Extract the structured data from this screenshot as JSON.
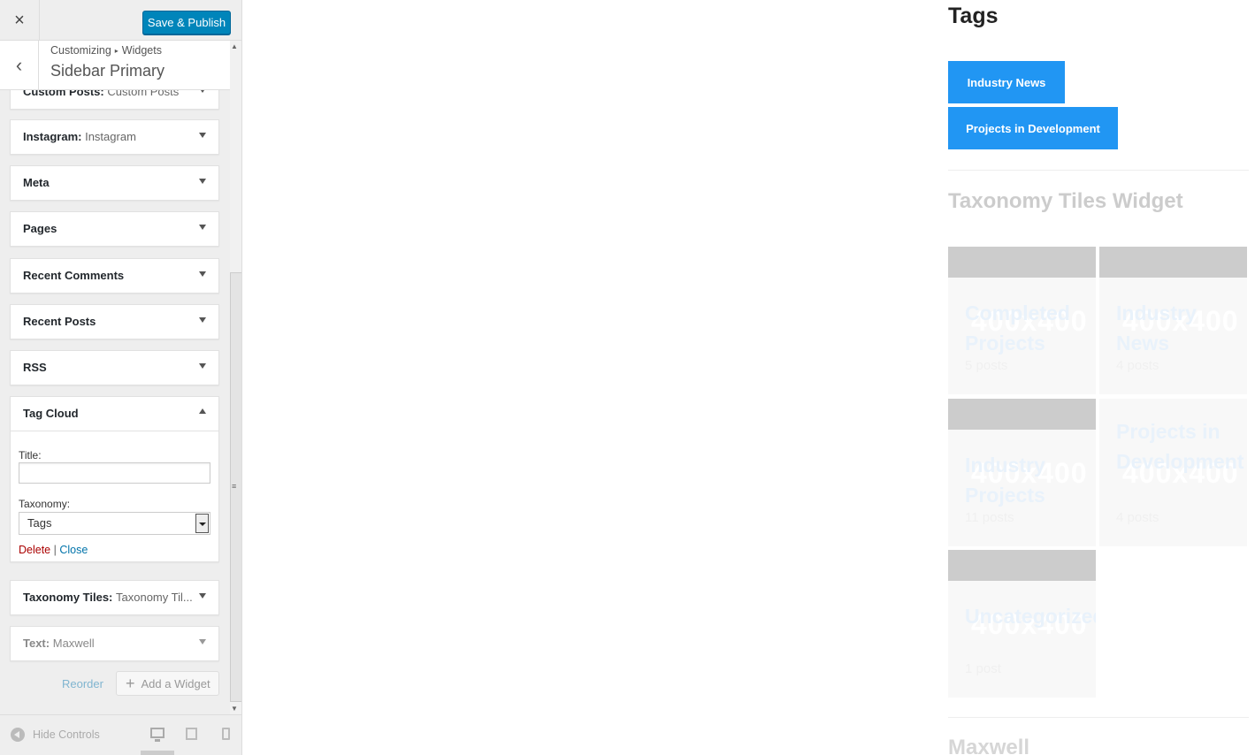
{
  "topbar": {
    "close_icon": "×",
    "publish_label": "Save & Publish"
  },
  "section": {
    "breadcrumb_root": "Customizing",
    "breadcrumb_sep": "▸",
    "breadcrumb_leaf": "Widgets",
    "title": "Sidebar Primary",
    "back_icon": "‹"
  },
  "scrollbar": {
    "up": "▲",
    "down": "▼",
    "grip": "≡"
  },
  "widgets": [
    {
      "title": "Custom Posts:",
      "subtitle": "Custom Posts"
    },
    {
      "title": "Instagram:",
      "subtitle": "Instagram"
    },
    {
      "title": "Meta",
      "subtitle": ""
    },
    {
      "title": "Pages",
      "subtitle": ""
    },
    {
      "title": "Recent Comments",
      "subtitle": ""
    },
    {
      "title": "Recent Posts",
      "subtitle": ""
    },
    {
      "title": "RSS",
      "subtitle": ""
    },
    {
      "title": "Tag Cloud",
      "subtitle": ""
    },
    {
      "title": "Taxonomy Tiles:",
      "subtitle": "Taxonomy Til..."
    },
    {
      "title": "Text:",
      "subtitle": "Maxwell"
    }
  ],
  "tag_cloud_form": {
    "title_label": "Title:",
    "title_value": "",
    "taxonomy_label": "Taxonomy:",
    "taxonomy_value": "Tags",
    "delete_label": "Delete",
    "separator": "|",
    "close_label": "Close"
  },
  "actions": {
    "reorder_label": "Reorder",
    "add_widget_plus": "+",
    "add_widget_label": "Add a Widget"
  },
  "footer": {
    "hide_controls_label": "Hide Controls"
  },
  "preview": {
    "tags_heading": "Tags",
    "tag_buttons": [
      "Industry News",
      "Projects in Development"
    ],
    "taxonomy_heading": "Taxonomy Tiles Widget",
    "placeholder": "400x400",
    "tiles": [
      {
        "name": "Completed Projects",
        "count": "5 posts"
      },
      {
        "name": "Industry News",
        "count": "4 posts"
      },
      {
        "name": "Industry Projects",
        "count": "11 posts"
      },
      {
        "name": "Projects in Development",
        "count": "4 posts"
      },
      {
        "name": "Uncategorized",
        "count": "1 post"
      }
    ],
    "bottom_heading": "Maxwell"
  },
  "colors": {
    "publish": "#0085ba",
    "tag_button": "#2196f3",
    "delete_link": "#a00",
    "close_link": "#0073aa"
  }
}
